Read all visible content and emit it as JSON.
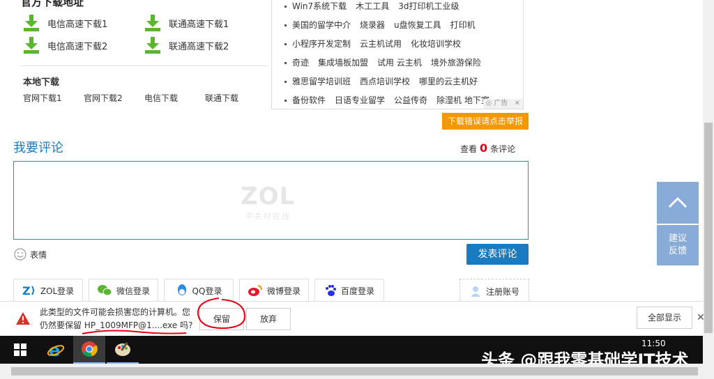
{
  "download": {
    "section_title": "官方下载地址",
    "telecom1": "电信高速下载1",
    "unicom1": "联通高速下载1",
    "telecom2": "电信高速下载2",
    "unicom2": "联通高速下载2",
    "local_title": "本地下载",
    "local_links": [
      "官网下载1",
      "官网下载2",
      "电信下载",
      "联通下载"
    ]
  },
  "ads": {
    "rows": [
      [
        "Win7系统下载",
        "木工工具",
        "3d打印机工业级"
      ],
      [
        "美国的留学中介",
        "烧录器",
        "u盘恢复工具",
        "打印机"
      ],
      [
        "小程序开发定制",
        "云主机试用",
        "化妆培训学校"
      ],
      [
        "奇迹",
        "集成墙板加盟",
        "试用 云主机",
        "境外旅游保险"
      ],
      [
        "雅思留学培训班",
        "西点培训学校",
        "哪里的云主机好"
      ],
      [
        "备份软件",
        "日语专业留学",
        "公益传奇",
        "除湿机 地下室"
      ]
    ],
    "tag": "广告",
    "close": "✕"
  },
  "report_label": "下载错误请点击举报",
  "comments": {
    "title": "我要评论",
    "view_prefix": "查看",
    "count": "0",
    "count_suffix": "条评论",
    "wm_big": "ZOL",
    "wm_small": "中关村在线",
    "emoji_label": "表情",
    "submit_label": "发表评论"
  },
  "logins": [
    "ZOL登录",
    "微信登录",
    "QQ登录",
    "微博登录",
    "百度登录"
  ],
  "register_label": "注册账号",
  "side": {
    "feedback_line1": "建议",
    "feedback_line2": "反馈"
  },
  "download_bar": {
    "warning_line1": "此类型的文件可能会损害您的计算机。您",
    "warning_line2": "仍然要保留 HP_1009MFP@1....exe 吗?",
    "keep": "保留",
    "discard": "放弃",
    "show_all": "全部显示",
    "close": "✕"
  },
  "taskbar": {
    "time": "11:50"
  },
  "watermark": "头条 @跟我零基础学IT技术",
  "colors": {
    "accent_blue": "#1a7bc1",
    "download_green": "#5cb531",
    "report_orange": "#f39800",
    "side_blue": "#88abd8",
    "warning_red": "#d3352b"
  }
}
